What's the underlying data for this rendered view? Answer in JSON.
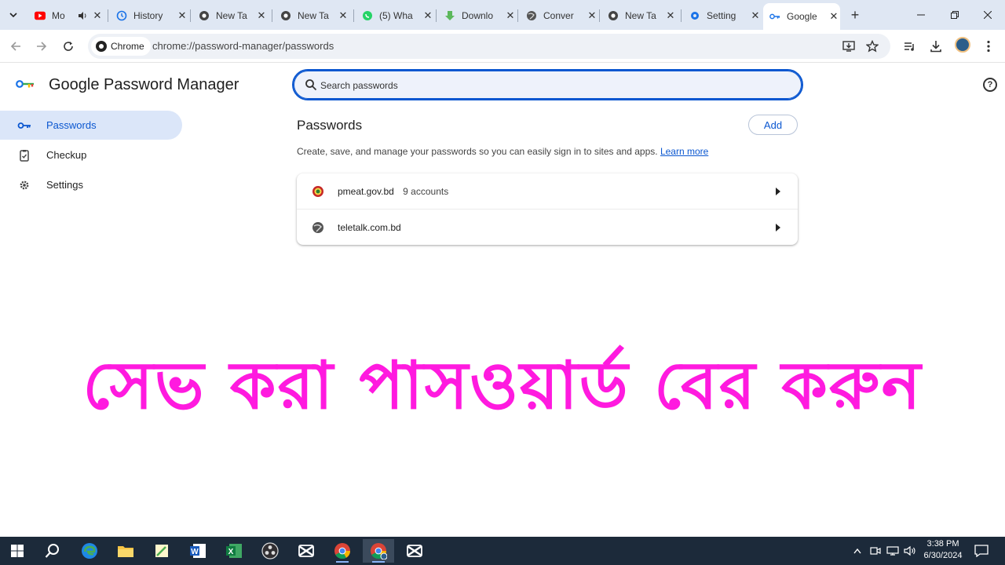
{
  "browser": {
    "tabs": [
      {
        "title": "Mo",
        "icon": "youtube-icon",
        "audio": true
      },
      {
        "title": "History",
        "icon": "history-icon"
      },
      {
        "title": "New Ta",
        "icon": "chrome-icon"
      },
      {
        "title": "New Ta",
        "icon": "chrome-icon"
      },
      {
        "title": "(5) Wha",
        "icon": "whatsapp-icon"
      },
      {
        "title": "Downlo",
        "icon": "download-arrow-icon"
      },
      {
        "title": "Conver",
        "icon": "globe-icon"
      },
      {
        "title": "New Ta",
        "icon": "chrome-icon"
      },
      {
        "title": "Setting",
        "icon": "gear-icon"
      },
      {
        "title": "Google",
        "icon": "key-icon",
        "active": true
      }
    ],
    "omnibox": {
      "chip_label": "Chrome",
      "url": "chrome://password-manager/passwords"
    }
  },
  "app": {
    "title": "Google Password Manager",
    "search_placeholder": "Search passwords",
    "nav": [
      {
        "label": "Passwords",
        "icon": "key-icon",
        "active": true
      },
      {
        "label": "Checkup",
        "icon": "checkup-icon"
      },
      {
        "label": "Settings",
        "icon": "gear-icon"
      }
    ],
    "section_title": "Passwords",
    "add_label": "Add",
    "description": "Create, save, and manage your passwords so you can easily sign in to sites and apps.",
    "learn_more": "Learn more",
    "entries": [
      {
        "site": "pmeat.gov.bd",
        "count": "9 accounts",
        "icon": "bd-govt-seal-icon"
      },
      {
        "site": "teletalk.com.bd",
        "count": "",
        "icon": "globe-icon"
      }
    ]
  },
  "overlay_text": "সেভ করা পাসওয়ার্ড বের করুন",
  "taskbar": {
    "time": "3:38 PM",
    "date": "6/30/2024"
  },
  "colors": {
    "accent": "#0b57d0",
    "overlay": "#ff1adf",
    "tabstrip": "#dfe7f3",
    "taskbar": "#1c2a3a"
  }
}
